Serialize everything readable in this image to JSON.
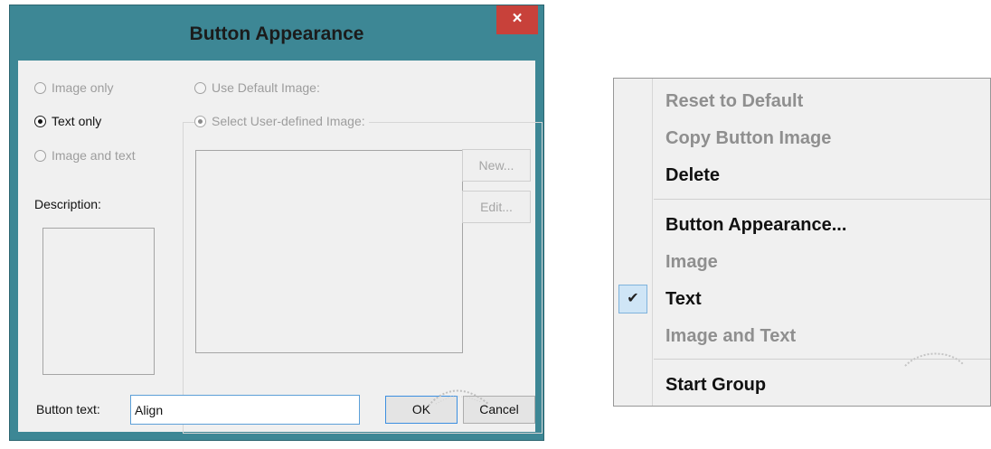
{
  "dialog": {
    "title": "Button Appearance",
    "close_glyph": "×",
    "radios_left": [
      {
        "label": "Image only",
        "checked": false,
        "enabled": false
      },
      {
        "label": "Text only",
        "checked": true,
        "enabled": true
      },
      {
        "label": "Image and text",
        "checked": false,
        "enabled": false
      }
    ],
    "radios_right": [
      {
        "label": "Use Default Image:",
        "checked": false,
        "enabled": false
      },
      {
        "label": "Select User-defined Image:",
        "checked": true,
        "enabled": false
      }
    ],
    "new_button": "New...",
    "edit_button": "Edit...",
    "description_label": "Description:",
    "button_text_label": "Button text:",
    "button_text_value": "Align",
    "ok_button": "OK",
    "cancel_button": "Cancel",
    "colors": {
      "frame": "#3d8795",
      "close": "#c8413a"
    }
  },
  "context_menu": {
    "items": [
      {
        "label": "Reset to Default",
        "enabled": false
      },
      {
        "label": "Copy Button Image",
        "enabled": false
      },
      {
        "label": "Delete",
        "enabled": true
      },
      {
        "label": "Button Appearance...",
        "enabled": true
      },
      {
        "label": "Image",
        "enabled": false
      },
      {
        "label": "Text",
        "enabled": true,
        "checked": true
      },
      {
        "label": "Image and Text",
        "enabled": false
      },
      {
        "label": "Start Group",
        "enabled": true
      }
    ],
    "check_glyph": "✔"
  }
}
